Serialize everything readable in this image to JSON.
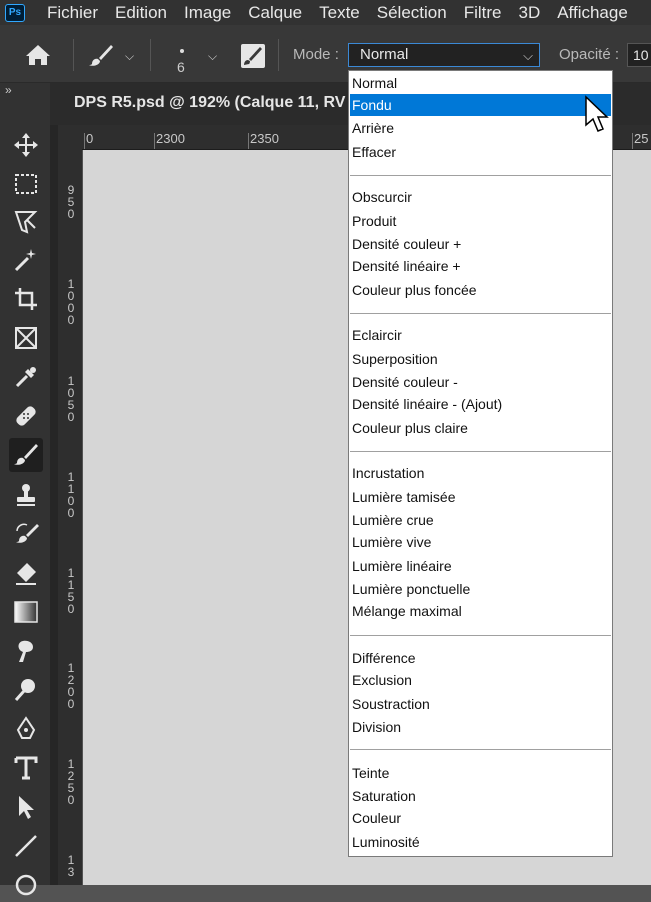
{
  "app": {
    "logo_text": "Ps"
  },
  "menubar": {
    "items": [
      "Fichier",
      "Edition",
      "Image",
      "Calque",
      "Texte",
      "Sélection",
      "Filtre",
      "3D",
      "Affichage"
    ]
  },
  "options": {
    "brush_size": "6",
    "mode_label": "Mode :",
    "mode_value": "Normal",
    "opacity_label": "Opacité :",
    "opacity_value": "10"
  },
  "toolbar": {
    "collapse_glyph": "»",
    "tools": [
      "move-tool",
      "marquee-tool",
      "lasso-tool",
      "magic-wand-tool",
      "crop-tool",
      "frame-tool",
      "eyedropper-tool",
      "healing-brush-tool",
      "brush-tool",
      "clone-stamp-tool",
      "history-brush-tool",
      "eraser-tool",
      "gradient-tool",
      "smudge-tool",
      "dodge-tool",
      "pen-tool",
      "type-tool",
      "path-selection-tool",
      "line-tool",
      "shape-tool"
    ],
    "active": "brush-tool"
  },
  "document": {
    "title": "DPS R5.psd @ 192% (Calque 11, RV"
  },
  "ruler": {
    "h_labels": [
      "0",
      "2300",
      "2350",
      "25"
    ],
    "v_labels": [
      "950",
      "1000",
      "1050",
      "1100",
      "1150",
      "1200",
      "1250",
      "13"
    ]
  },
  "dropdown": {
    "selected": "Fondu",
    "groups": [
      [
        "Normal",
        "Fondu",
        "Arrière",
        "Effacer"
      ],
      [
        "Obscurcir",
        "Produit",
        "Densité couleur +",
        "Densité linéaire +",
        "Couleur plus foncée"
      ],
      [
        "Eclaircir",
        "Superposition",
        "Densité couleur -",
        "Densité linéaire - (Ajout)",
        "Couleur plus claire"
      ],
      [
        "Incrustation",
        "Lumière tamisée",
        "Lumière crue",
        "Lumière vive",
        "Lumière linéaire",
        "Lumière ponctuelle",
        "Mélange maximal"
      ],
      [
        "Différence",
        "Exclusion",
        "Soustraction",
        "Division"
      ],
      [
        "Teinte",
        "Saturation",
        "Couleur",
        "Luminosité"
      ]
    ]
  },
  "colors": {
    "accent": "#0078d7",
    "canvas": "#d6d6d6",
    "ui_dark": "#323232"
  }
}
